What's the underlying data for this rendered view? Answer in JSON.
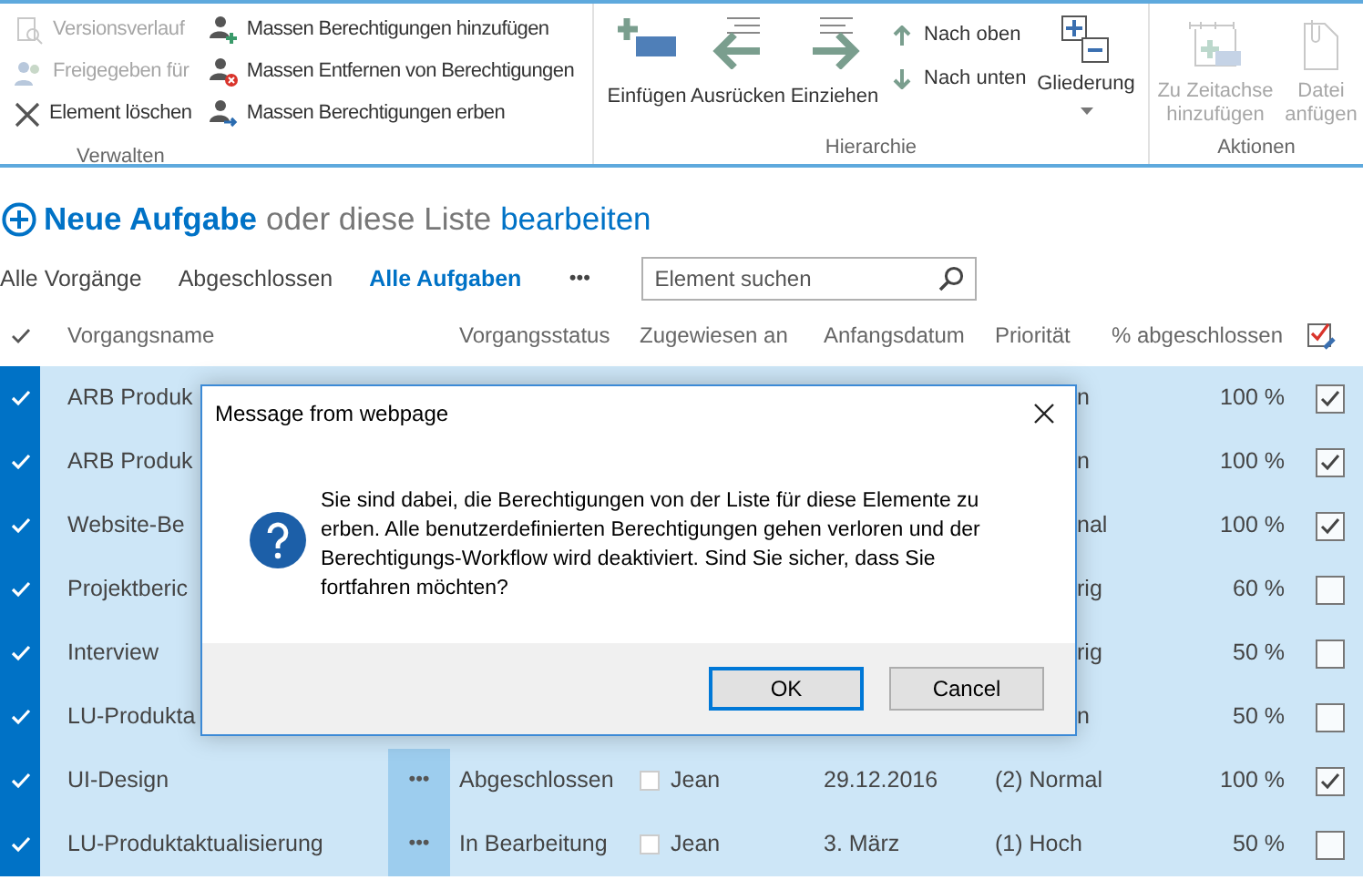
{
  "ribbon": {
    "groups": [
      {
        "label": "Verwalten",
        "items": [
          {
            "label": "Versionsverlauf",
            "disabled": true
          },
          {
            "label": "Freigegeben für",
            "disabled": true
          },
          {
            "label": "Element löschen",
            "disabled": false
          },
          {
            "label": "Massen Berechtigungen hinzufügen",
            "disabled": false
          },
          {
            "label": "Massen Entfernen von Berechtigungen",
            "disabled": false
          },
          {
            "label": "Massen Berechtigungen erben",
            "disabled": false
          }
        ]
      },
      {
        "label": "Hierarchie",
        "items": [
          {
            "label": "Einfügen",
            "disabled": false
          },
          {
            "label": "Ausrücken",
            "disabled": false
          },
          {
            "label": "Einziehen",
            "disabled": false
          },
          {
            "label": "Nach oben",
            "disabled": false
          },
          {
            "label": "Nach unten",
            "disabled": false
          },
          {
            "label": "Gliederung",
            "disabled": false
          }
        ]
      },
      {
        "label": "Aktionen",
        "items": [
          {
            "label": "Zu Zeitachse hinzufügen",
            "disabled": true
          },
          {
            "label": "Datei anfügen",
            "disabled": true
          }
        ]
      }
    ]
  },
  "heading": {
    "new_item": "Neue Aufgabe",
    "middle": "oder diese Liste",
    "edit": "bearbeiten"
  },
  "views": [
    {
      "label": "Alle Vorgänge",
      "selected": false
    },
    {
      "label": "Abgeschlossen",
      "selected": false
    },
    {
      "label": "Alle Aufgaben",
      "selected": true
    }
  ],
  "more_views": "•••",
  "search": {
    "placeholder": "Element suchen"
  },
  "table": {
    "columns": [
      "Vorgangsname",
      "Vorgangsstatus",
      "Zugewiesen an",
      "Anfangsdatum",
      "Priorität",
      "% abgeschlossen"
    ],
    "rows": [
      {
        "selected": true,
        "name": "ARB Produk",
        "fragment": "n",
        "percent": "100 %",
        "done": true
      },
      {
        "selected": true,
        "name": "ARB Produk",
        "fragment": "n",
        "percent": "100 %",
        "done": true
      },
      {
        "selected": true,
        "name": "Website-Be",
        "fragment": "nal",
        "percent": "100 %",
        "done": true
      },
      {
        "selected": true,
        "name": "Projektberic",
        "fragment": "rig",
        "percent": "60 %",
        "done": false
      },
      {
        "selected": true,
        "name": "Interview",
        "fragment": "rig",
        "percent": "50 %",
        "done": false
      },
      {
        "selected": true,
        "name": "LU-Produkta",
        "fragment": "n",
        "percent": "50 %",
        "done": false
      },
      {
        "selected": true,
        "name": "UI-Design",
        "menu": "•••",
        "status": "Abgeschlossen",
        "assigned": "Jean",
        "assignee_checked": false,
        "start": "29.12.2016",
        "priority": "(2) Normal",
        "percent": "100 %",
        "done": true
      },
      {
        "selected": true,
        "name": "LU-Produktaktualisierung",
        "menu": "•••",
        "status": "In Bearbeitung",
        "assigned": "Jean",
        "assignee_checked": false,
        "start": "3. März",
        "priority": "(1) Hoch",
        "percent": "50 %",
        "done": false
      }
    ]
  },
  "dialog": {
    "title": "Message from webpage",
    "message": "Sie sind dabei, die Berechtigungen von der Liste für diese Elemente zu erben. Alle benutzerdefinierten Berechtigungen gehen verloren und der Berechtigungs-Workflow wird deaktiviert. Sind Sie sicher, dass Sie fortfahren möchten?",
    "buttons": [
      "OK",
      "Cancel"
    ]
  }
}
